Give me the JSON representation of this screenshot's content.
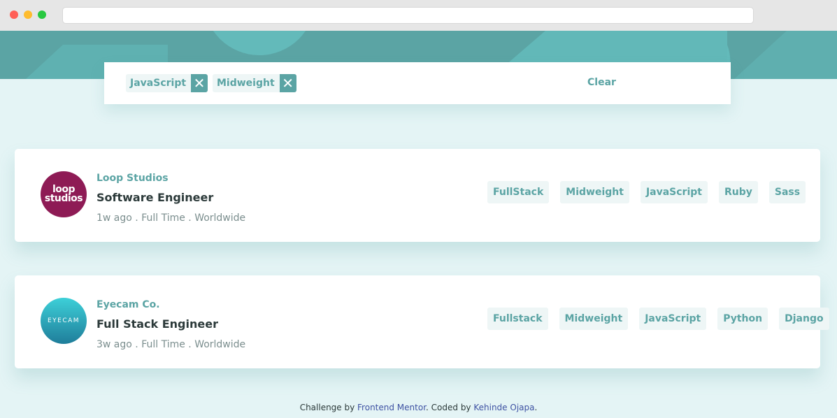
{
  "filters": {
    "chips": [
      {
        "label": "JavaScript"
      },
      {
        "label": "Midweight"
      }
    ],
    "remove_symbol": "✕",
    "clear_label": "Clear"
  },
  "jobs": [
    {
      "logo_text": "loop studios",
      "company": "Loop Studios",
      "position": "Software Engineer",
      "meta": "1w ago .  Full Time .  Worldwide",
      "tags": [
        "FullStack",
        "Midweight",
        "JavaScript",
        "Ruby",
        "Sass"
      ]
    },
    {
      "logo_text": "EYECAM",
      "company": "Eyecam Co.",
      "position": "Full Stack Engineer",
      "meta": "3w ago .  Full Time .  Worldwide",
      "tags": [
        "Fullstack",
        "Midweight",
        "JavaScript",
        "Python",
        "Django"
      ]
    }
  ],
  "footer": {
    "prefix": "Challenge by ",
    "link1": "Frontend Mentor",
    "middle": ". Coded by ",
    "link2": "Kehinde Ojapa",
    "suffix": "."
  },
  "colors": {
    "primary": "#5ba4a4",
    "background": "#e4f4f5",
    "tag_bg": "#eef6f6",
    "loop_logo": "#8e1b55"
  }
}
